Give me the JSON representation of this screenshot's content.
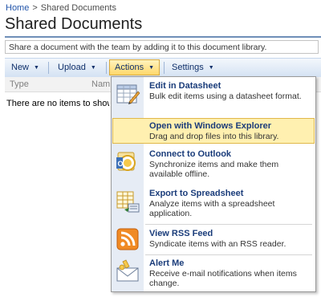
{
  "breadcrumb": {
    "home": "Home",
    "separator": ">",
    "current": "Shared Documents"
  },
  "page_title": "Shared Documents",
  "description": "Share a document with the team by adding it to this document library.",
  "toolbar": {
    "new_label": "New",
    "upload_label": "Upload",
    "actions_label": "Actions",
    "settings_label": "Settings",
    "dropdown_arrow": "▼"
  },
  "columns": {
    "type": "Type",
    "name": "Nam"
  },
  "empty_message": "There are no items to show in this view of the \"Shared Documents\" document library.",
  "actions_menu": {
    "items": [
      {
        "title": "Edit in Datasheet",
        "description": "Bulk edit items using a datasheet format.",
        "icon": "datasheet-icon"
      },
      {
        "title": "Open with Windows Explorer",
        "description": "Drag and drop files into this library.",
        "icon": "windows-explorer-icon"
      },
      {
        "title": "Connect to Outlook",
        "description": "Synchronize items and make them available offline.",
        "icon": "outlook-icon"
      },
      {
        "title": "Export to Spreadsheet",
        "description": "Analyze items with a spreadsheet application.",
        "icon": "spreadsheet-icon"
      },
      {
        "title": "View RSS Feed",
        "description": "Syndicate items with an RSS reader.",
        "icon": "rss-icon"
      },
      {
        "title": "Alert Me",
        "description": "Receive e-mail notifications when items change.",
        "icon": "alert-icon"
      }
    ]
  },
  "colors": {
    "accent": "#2255aa",
    "highlight": "#fff0b0",
    "rss": "#f08a24"
  }
}
